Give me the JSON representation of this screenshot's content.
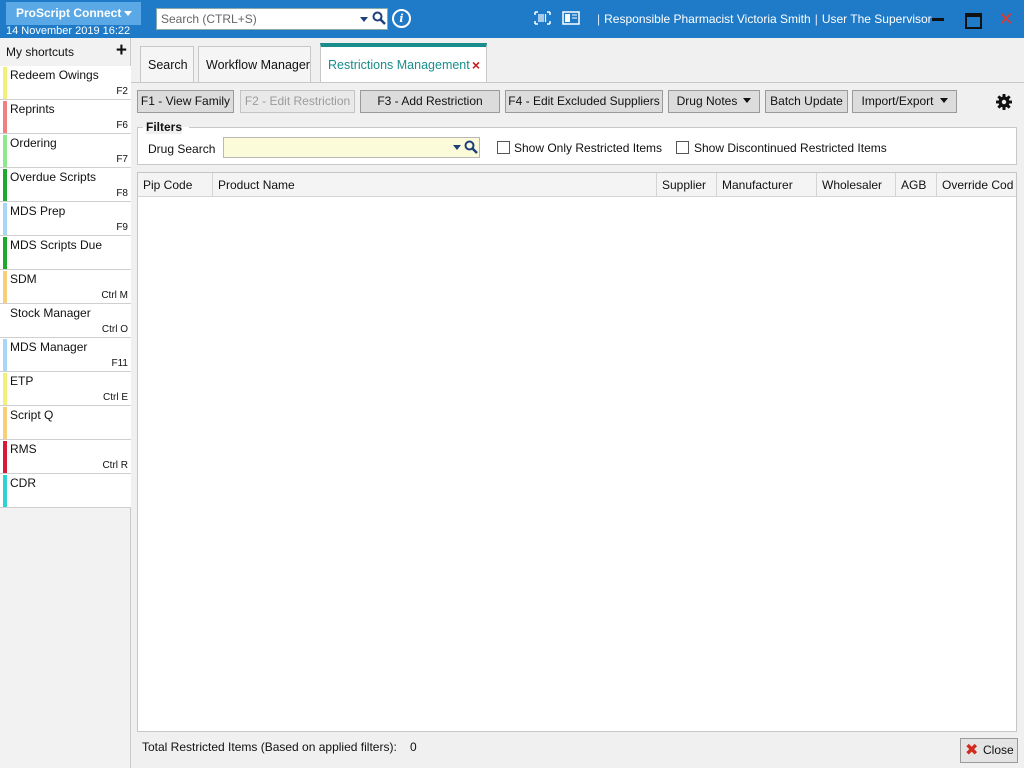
{
  "app": {
    "name": "ProScript Connect",
    "datetime": "14 November 2019 16:22"
  },
  "global_search": {
    "placeholder": "Search (CTRL+S)"
  },
  "header": {
    "pharmacist_label": "Responsible Pharmacist",
    "pharmacist_name": "Victoria Smith",
    "user_label": "User",
    "user_name": "The Supervisor"
  },
  "sidebar": {
    "title": "My shortcuts",
    "add_symbol": "+",
    "items": [
      {
        "label": "Redeem Owings",
        "key": "F2",
        "color": "#f2ef7a"
      },
      {
        "label": "Reprints",
        "key": "F6",
        "color": "#f08080"
      },
      {
        "label": "Ordering",
        "key": "F7",
        "color": "#8ee98e"
      },
      {
        "label": "Overdue Scripts",
        "key": "F8",
        "color": "#1fa82b"
      },
      {
        "label": "MDS Prep",
        "key": "F9",
        "color": "#a9d6f5"
      },
      {
        "label": "MDS Scripts Due",
        "key": "",
        "color": "#1fa82b"
      },
      {
        "label": "SDM",
        "key": "Ctrl M",
        "color": "#f7cf7a"
      },
      {
        "label": "Stock Manager",
        "key": "Ctrl O",
        "color": "#ffffff"
      },
      {
        "label": "MDS Manager",
        "key": "F11",
        "color": "#a9d6f5"
      },
      {
        "label": "ETP",
        "key": "Ctrl E",
        "color": "#f2ef7a"
      },
      {
        "label": "Script Q",
        "key": "",
        "color": "#f7cf7a"
      },
      {
        "label": "RMS",
        "key": "Ctrl R",
        "color": "#d81b3b"
      },
      {
        "label": "CDR",
        "key": "",
        "color": "#2fd3d3"
      }
    ]
  },
  "tabs": [
    {
      "label": "Search"
    },
    {
      "label": "Workflow Manager"
    },
    {
      "label": "Restrictions Management",
      "active": true,
      "close_symbol": "×"
    }
  ],
  "toolbar": {
    "view_family": "F1 - View Family",
    "edit_restriction": "F2 - Edit Restriction",
    "add_restriction": "F3 - Add Restriction",
    "edit_excluded": "F4 - Edit Excluded Suppliers",
    "drug_notes": "Drug Notes",
    "batch_update": "Batch Update",
    "import_export": "Import/Export"
  },
  "filters": {
    "legend": "Filters",
    "drug_search_label": "Drug Search",
    "drug_search_value": "",
    "show_only_restricted": {
      "label": "Show Only Restricted Items",
      "checked": false
    },
    "show_discontinued": {
      "label": "Show Discontinued Restricted Items",
      "checked": false
    }
  },
  "grid": {
    "columns": [
      "Pip Code",
      "Product Name",
      "Supplier",
      "Manufacturer",
      "Wholesaler",
      "AGB",
      "Override Cod"
    ],
    "rows": []
  },
  "footer": {
    "total_label": "Total Restricted Items (Based on applied filters):",
    "total_value": "0",
    "close_label": "Close"
  },
  "colors": {
    "titlebar": "#1f7ac7",
    "active_tab": "#1a8c8c",
    "drug_search_bg": "#fbfbd9"
  }
}
